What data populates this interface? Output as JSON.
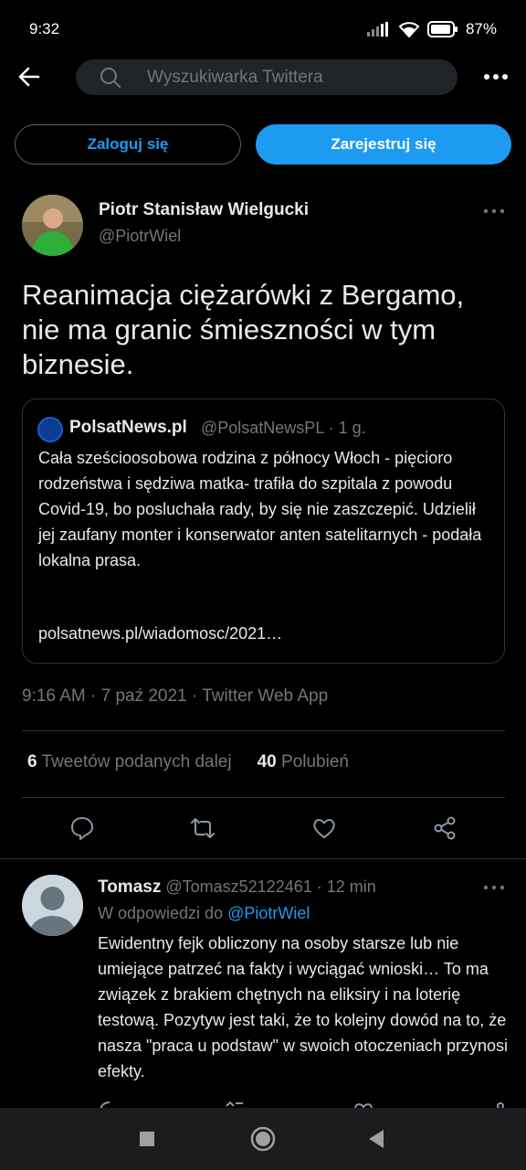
{
  "status": {
    "time": "9:32",
    "battery": "87%"
  },
  "header": {
    "search_placeholder": "Wyszukiwarka Twittera"
  },
  "auth": {
    "login_label": "Zaloguj się",
    "signup_label": "Zarejestruj się"
  },
  "tweet": {
    "author_name": "Piotr Stanisław Wielgucki",
    "author_handle": "@PiotrWiel",
    "text": "Reanimacja ciężarówki z Bergamo, nie ma granic śmieszności w tym biznesie.",
    "timestamp": "9:16 AM · 7 paź 2021 · Twitter Web App",
    "retweets_count": "6",
    "retweets_label": "Tweetów podanych dalej",
    "likes_count": "40",
    "likes_label": "Polubień"
  },
  "quote": {
    "name": "PolsatNews.pl",
    "meta": "@PolsatNewsPL · 1 g.",
    "text": "Cała sześcioosobowa rodzina z północy Włoch - pięcioro rodzeństwa i sędziwa matka- trafiła do szpitala z powodu Covid-19, bo posluchała rady, by się nie zaszczepić. Udzielił jej zaufany monter i konserwator anten satelitarnych - podała lokalna prasa.",
    "link": "polsatnews.pl/wiadomosc/2021…"
  },
  "reply": {
    "author_name": "Tomasz",
    "meta": "@Tomasz52122461 · 12 min",
    "reply_to_prefix": "W odpowiedzi do",
    "reply_to_handle": "@PiotrWiel",
    "text": "Ewidentny fejk obliczony na osoby starsze lub nie umiejące patrzeć na fakty i wyciągać wnioski… To ma związek z brakiem chętnych na eliksiry i na loterię testową. Pozytyw jest taki, że to kolejny dowód na to, że nasza \"praca u podstaw\" w swoich otoczeniach przynosi efekty."
  },
  "colors": {
    "accent": "#1d9bf0",
    "background": "#000000",
    "muted": "#71767b"
  }
}
